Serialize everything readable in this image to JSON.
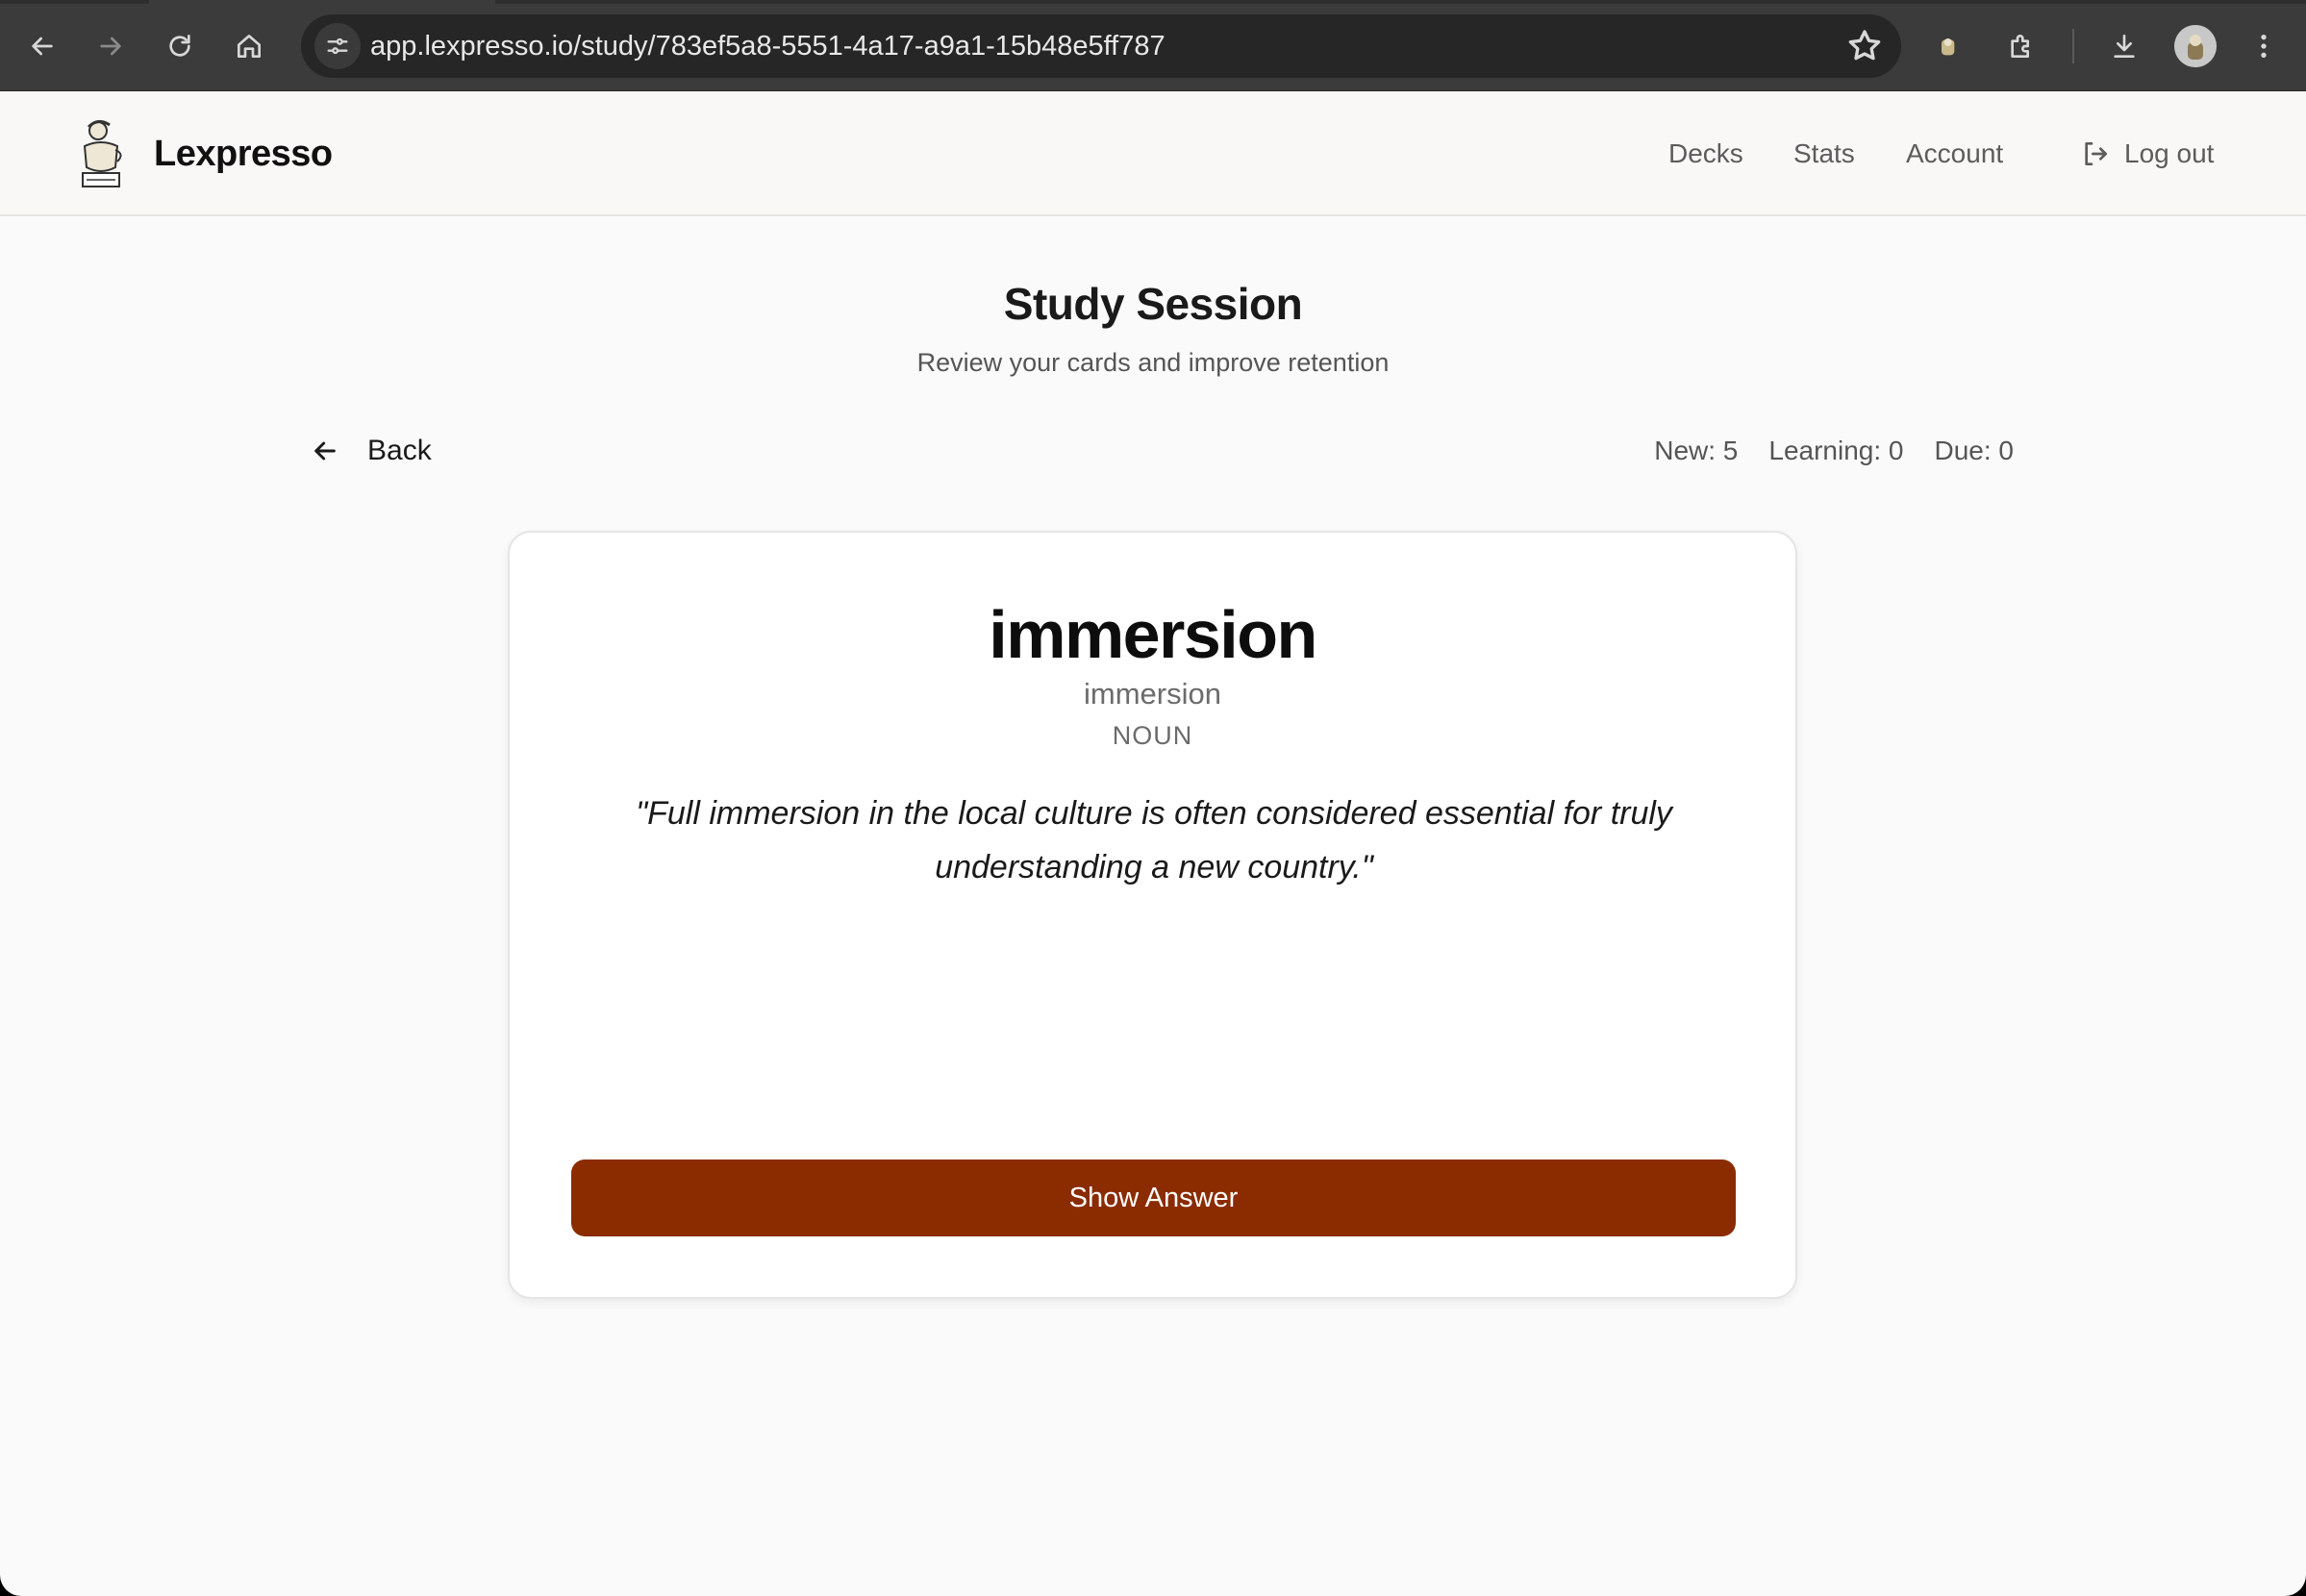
{
  "browser": {
    "url": "app.lexpresso.io/study/783ef5a8-5551-4a17-a9a1-15b48e5ff787",
    "icons": [
      "back-arrow-icon",
      "forward-arrow-icon",
      "reload-icon",
      "home-icon",
      "site-settings-icon",
      "bookmark-star-icon",
      "extension-icon",
      "puzzle-icon",
      "download-icon",
      "kebab-menu-icon"
    ]
  },
  "header": {
    "brand": "Lexpresso",
    "nav": {
      "decks": "Decks",
      "stats": "Stats",
      "account": "Account"
    },
    "logout": "Log out"
  },
  "page": {
    "title": "Study Session",
    "subtitle": "Review your cards and improve retention",
    "back": "Back"
  },
  "counts": {
    "new": "New: 5",
    "learning": "Learning: 0",
    "due": "Due: 0"
  },
  "card": {
    "word": "immersion",
    "transliteration": "immersion",
    "part_of_speech": "NOUN",
    "example": "\"Full immersion in the local culture is often considered essential for truly understanding a new country.\"",
    "show_answer": "Show Answer"
  },
  "colors": {
    "accent": "#8a2c00",
    "chrome": "#3b3b3b",
    "page_bg": "#fafafa"
  }
}
